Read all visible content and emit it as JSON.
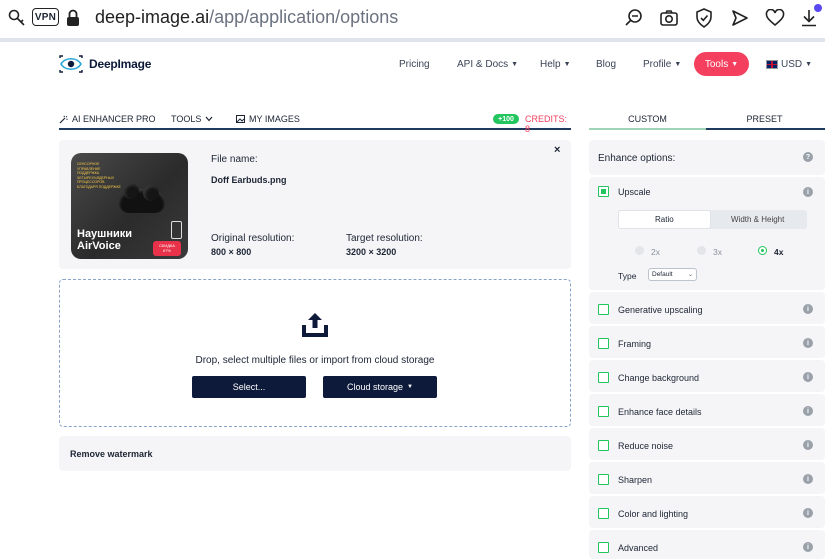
{
  "browser": {
    "vpn_label": "VPN",
    "url_domain": "deep-image.ai",
    "url_path": "/app/application/options",
    "icons": [
      "search-key-icon",
      "lock-icon",
      "zoom-out-icon",
      "camera-icon",
      "shield-check-icon",
      "send-icon",
      "heart-icon",
      "download-icon"
    ]
  },
  "header": {
    "logo_text": "DeepImage",
    "nav": [
      "Pricing",
      "API & Docs",
      "Help",
      "Blog",
      "Profile"
    ],
    "tools_label": "Tools",
    "currency": "USD"
  },
  "colors": {
    "accent": "#f43f5e",
    "navy": "#0d1a3a",
    "green": "#22c55e"
  },
  "left_tabs": {
    "enhancer": "AI ENHANCER PRO",
    "tools": "TOOLS",
    "my_images": "MY IMAGES",
    "credits_badge": "+100",
    "credits": "CREDITS: 8"
  },
  "file": {
    "name_label": "File name:",
    "name": "Doff Earbuds.png",
    "orig_label": "Original resolution:",
    "orig_value": "800 × 800",
    "target_label": "Target resolution:",
    "target_value": "3200 × 3200",
    "close": "×",
    "thumb": {
      "yellow_text": "СЕНСОРНОЕ УПРАВЛЕНИЕ ПОДДЕРЖКА ЧЕТЫРЕХЪЯДЕРНЫХ ПРОЦЕССОРОВ БЛАГОДАРЯ ПОДДЕРЖКЕ",
      "title_line1": "Наушники",
      "title_line2": "AirVoice",
      "sale_line1": "СКИДКА",
      "sale_line2": "67%"
    }
  },
  "dropzone": {
    "text": "Drop, select multiple files or import from cloud storage",
    "select_label": "Select...",
    "cloud_label": "Cloud storage"
  },
  "watermark_label": "Remove watermark",
  "right_tabs": {
    "custom": "CUSTOM",
    "preset": "PRESET"
  },
  "enhance": {
    "title": "Enhance options:",
    "upscale": "Upscale",
    "seg_ratio": "Ratio",
    "seg_wh": "Width & Height",
    "ratios": [
      "2x",
      "3x",
      "4x"
    ],
    "selected_ratio": "4x",
    "type_label": "Type",
    "type_value": "Default",
    "options": [
      "Generative upscaling",
      "Framing",
      "Change background",
      "Enhance face details",
      "Reduce noise",
      "Sharpen",
      "Color and lighting",
      "Advanced"
    ]
  }
}
